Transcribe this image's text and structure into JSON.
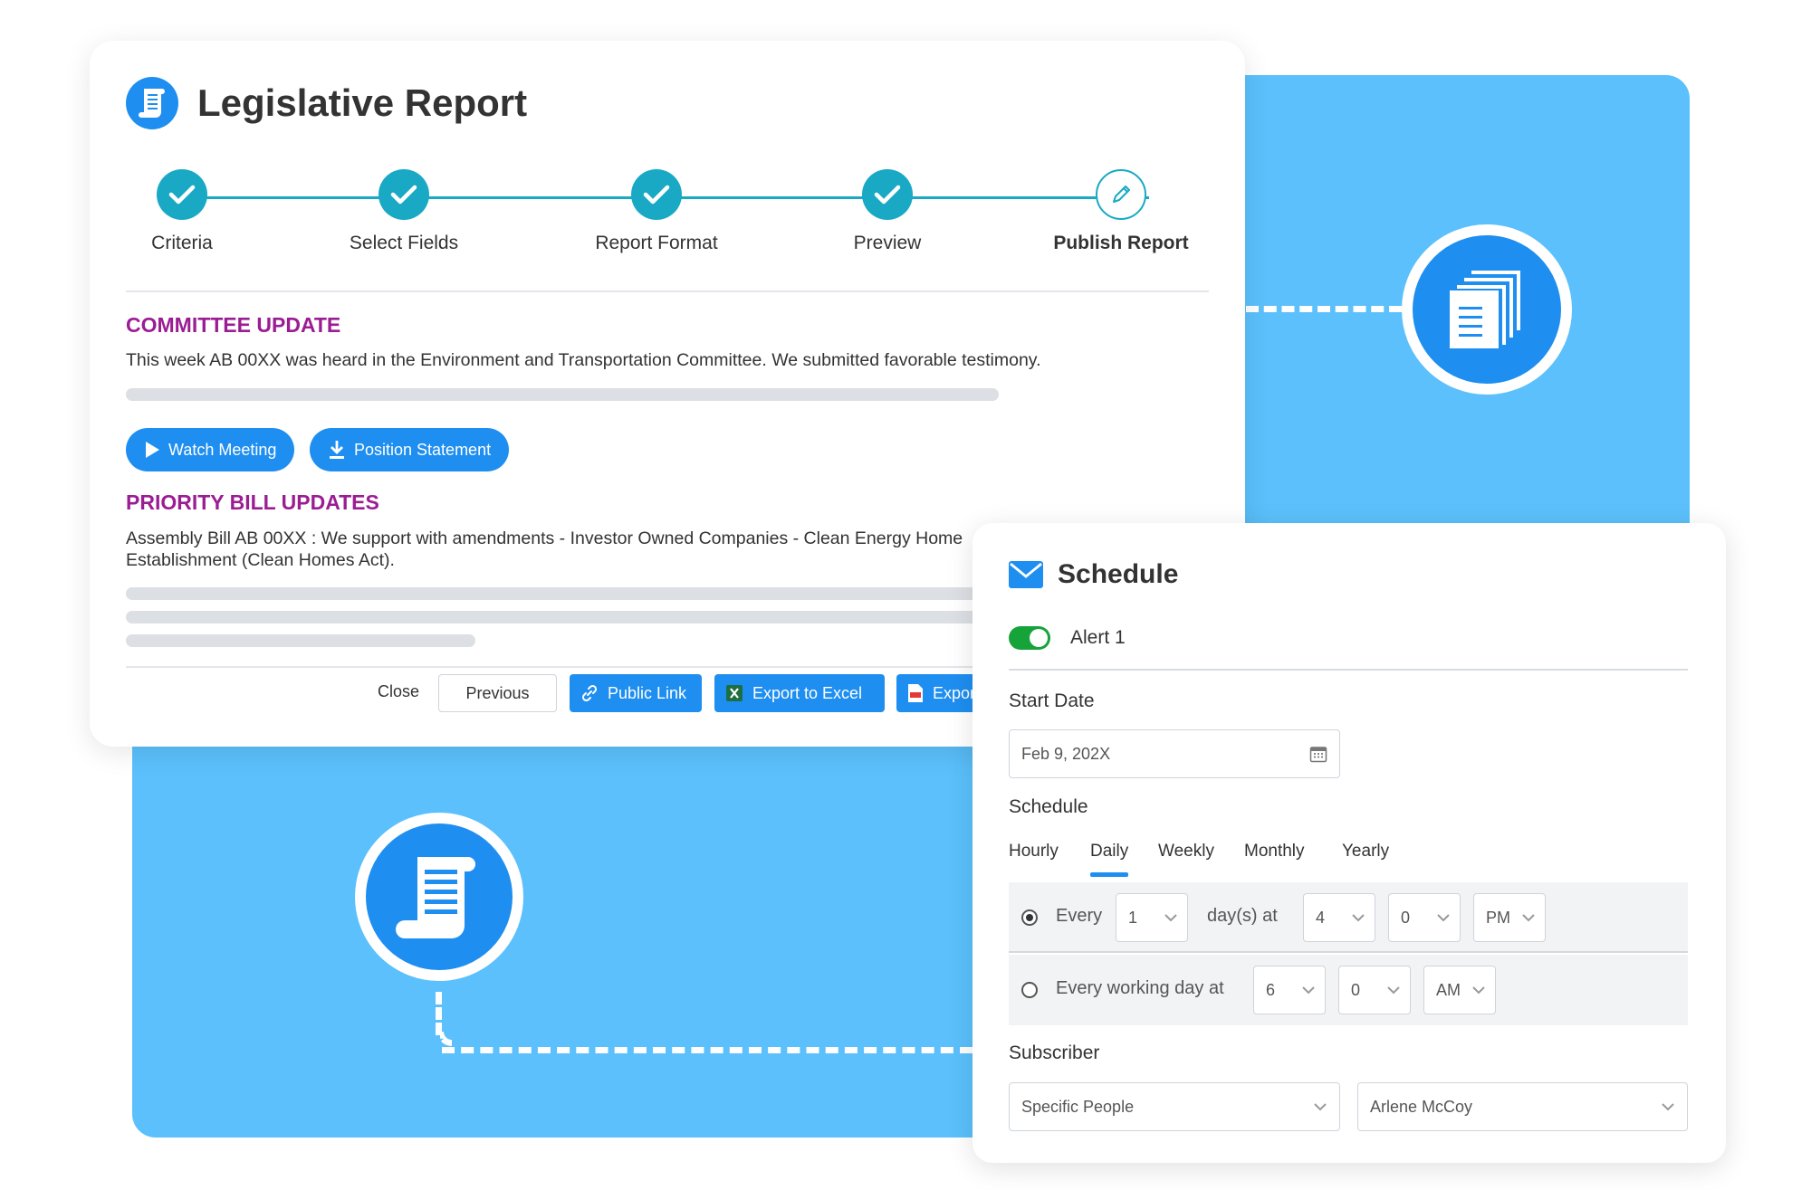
{
  "report": {
    "title": "Legislative Report",
    "steps": [
      {
        "label": "Criteria",
        "state": "done"
      },
      {
        "label": "Select Fields",
        "state": "done"
      },
      {
        "label": "Report Format",
        "state": "done"
      },
      {
        "label": "Preview",
        "state": "done"
      },
      {
        "label": "Publish Report",
        "state": "current"
      }
    ],
    "committee": {
      "heading": "COMMITTEE UPDATE",
      "text": "This week AB 00XX was heard in the Environment and Transportation Committee. We submitted favorable testimony.",
      "watch_label": "Watch Meeting",
      "position_label": "Position Statement"
    },
    "priority": {
      "heading": "PRIORITY BILL UPDATES",
      "line1": "Assembly Bill AB 00XX : We support with amendments - Investor Owned Companies - Clean Energy Home",
      "line2": "Establishment (Clean Homes Act)."
    },
    "footer": {
      "close_label": "Close",
      "previous_label": "Previous",
      "public_link_label": "Public Link",
      "export_excel_label": "Export to Excel",
      "export_pdf_label": "Expor"
    }
  },
  "schedule": {
    "title": "Schedule",
    "alert_label": "Alert 1",
    "alert_enabled": true,
    "start_date_label": "Start Date",
    "start_date_value": "Feb 9, 202X",
    "schedule_label": "Schedule",
    "tabs": [
      "Hourly",
      "Daily",
      "Weekly",
      "Monthly",
      "Yearly"
    ],
    "active_tab": "Daily",
    "option1": {
      "every_label": "Every",
      "interval": "1",
      "days_at_label": "day(s) at",
      "hour": "4",
      "minute": "0",
      "ampm": "PM",
      "selected": true
    },
    "option2": {
      "label": "Every working day at",
      "hour": "6",
      "minute": "0",
      "ampm": "AM",
      "selected": false
    },
    "subscriber_label": "Subscriber",
    "subscriber_type": "Specific People",
    "subscriber_person": "Arlene McCoy"
  },
  "colors": {
    "accent_blue": "#1e8ef0",
    "panel_blue": "#5bc0fb",
    "step_teal": "#19a9c4",
    "heading_purple": "#9b1d94",
    "toggle_green": "#16a33a"
  }
}
